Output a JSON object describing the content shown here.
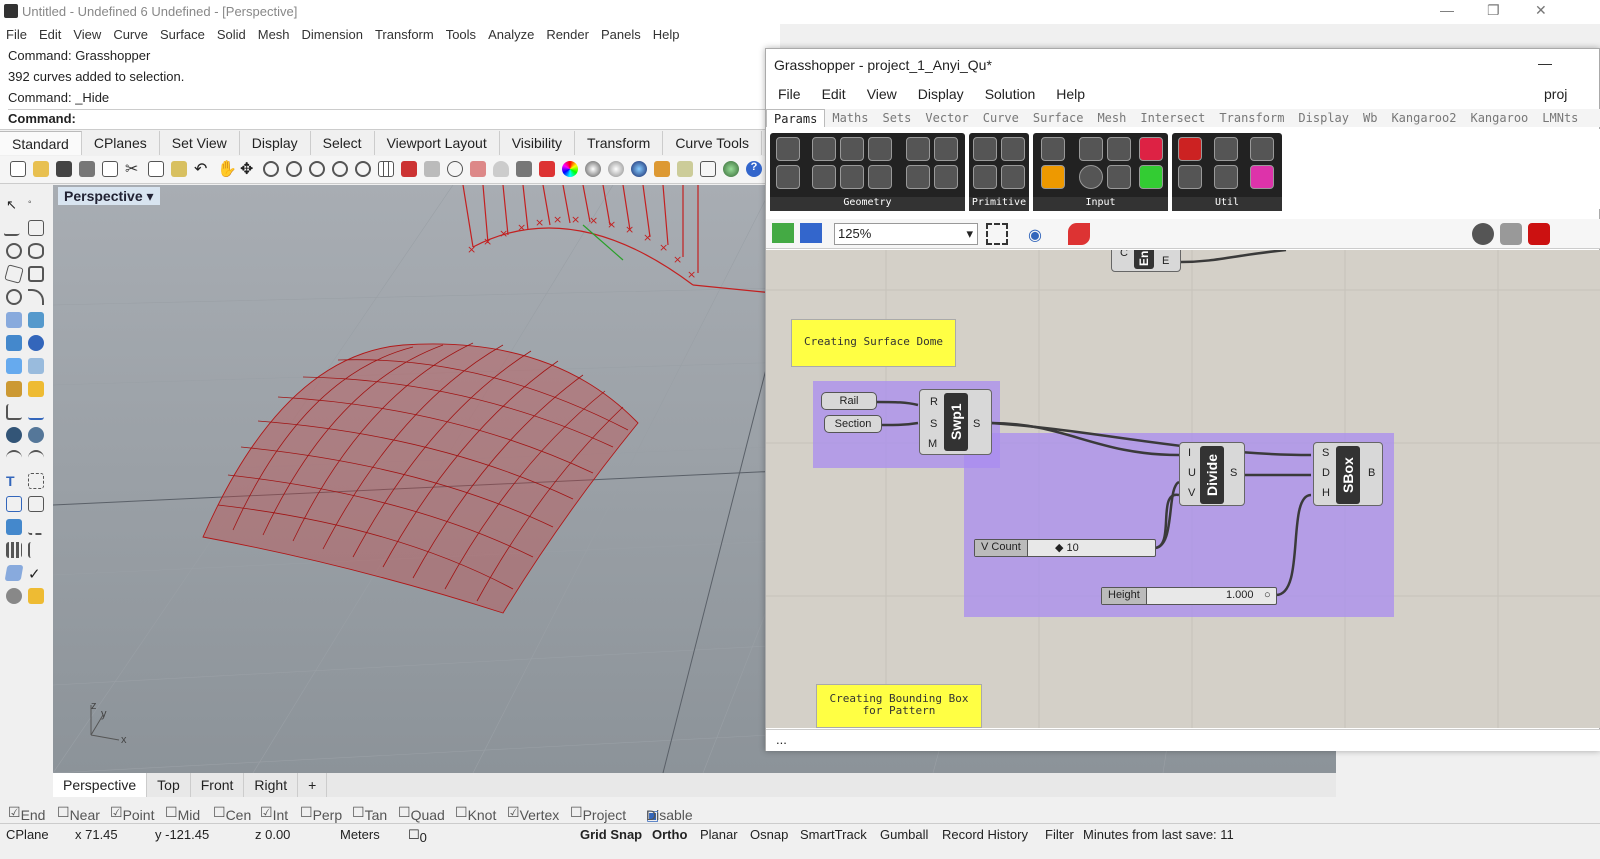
{
  "window": {
    "title": "Untitled - Undefined 6 Undefined - [Perspective]",
    "minimize": "—",
    "restore": "❐",
    "close": "✕"
  },
  "menu": [
    "File",
    "Edit",
    "View",
    "Curve",
    "Surface",
    "Solid",
    "Mesh",
    "Dimension",
    "Transform",
    "Tools",
    "Analyze",
    "Render",
    "Panels",
    "Help"
  ],
  "command": {
    "line1": "Command: Grasshopper",
    "line2": "392 curves added to selection.",
    "line3": "Command: _Hide",
    "prompt": "Command:"
  },
  "toolbar_tabs": [
    "Standard",
    "CPlanes",
    "Set View",
    "Display",
    "Select",
    "Viewport Layout",
    "Visibility",
    "Transform",
    "Curve Tools"
  ],
  "viewport": {
    "label": "Perspective",
    "axis_y": "y",
    "axis_z": "z",
    "axis_x": "x"
  },
  "viewport_tabs": [
    "Perspective",
    "Top",
    "Front",
    "Right",
    "+"
  ],
  "osnap": [
    {
      "label": "End",
      "checked": true
    },
    {
      "label": "Near",
      "checked": false
    },
    {
      "label": "Point",
      "checked": true
    },
    {
      "label": "Mid",
      "checked": false
    },
    {
      "label": "Cen",
      "checked": false
    },
    {
      "label": "Int",
      "checked": true
    },
    {
      "label": "Perp",
      "checked": false
    },
    {
      "label": "Tan",
      "checked": false
    },
    {
      "label": "Quad",
      "checked": false
    },
    {
      "label": "Knot",
      "checked": false
    },
    {
      "label": "Vertex",
      "checked": true
    },
    {
      "label": "Project",
      "checked": false
    },
    {
      "label": "Disable",
      "checked": true
    }
  ],
  "status": {
    "cplane": "CPlane",
    "x": "x 71.45",
    "y": "y -121.45",
    "z": "z 0.00",
    "units": "Meters",
    "layer": "0",
    "grid_snap": "Grid Snap",
    "ortho": "Ortho",
    "planar": "Planar",
    "osnap": "Osnap",
    "smarttrack": "SmartTrack",
    "gumball": "Gumball",
    "record": "Record History",
    "filter": "Filter",
    "minutes": "Minutes from last save: 11"
  },
  "gh": {
    "title": "Grasshopper - project_1_Anyi_Qu*",
    "title_right": "proj",
    "min": "—",
    "menu": [
      "File",
      "Edit",
      "View",
      "Display",
      "Solution",
      "Help"
    ],
    "tabs": [
      "Params",
      "Maths",
      "Sets",
      "Vector",
      "Curve",
      "Surface",
      "Mesh",
      "Intersect",
      "Transform",
      "Display",
      "Wb",
      "Kangaroo2",
      "Kangaroo",
      "LMNts"
    ],
    "ribbon_groups": [
      "Geometry",
      "Primitive",
      "Input",
      "Util"
    ],
    "zoom": "125%",
    "notes": {
      "dome": "Creating Surface Dome",
      "bbox1": "Creating Bounding Box",
      "bbox2": "for Pattern"
    },
    "params": {
      "rail": "Rail",
      "section": "Section"
    },
    "sweep": {
      "name": "Swp1",
      "in": [
        "R",
        "S",
        "M"
      ],
      "out": "S"
    },
    "divide": {
      "name": "Divide",
      "in": [
        "I",
        "U",
        "V"
      ],
      "out": "S"
    },
    "sbox": {
      "name": "SBox",
      "in": [
        "S",
        "D",
        "H"
      ],
      "out": "B"
    },
    "top_comp": {
      "name": "En",
      "in": "C",
      "out": "E"
    },
    "vcount": {
      "label": "V Count",
      "value": "◆ 10"
    },
    "height": {
      "label": "Height",
      "value": "1.000"
    },
    "status": "..."
  }
}
